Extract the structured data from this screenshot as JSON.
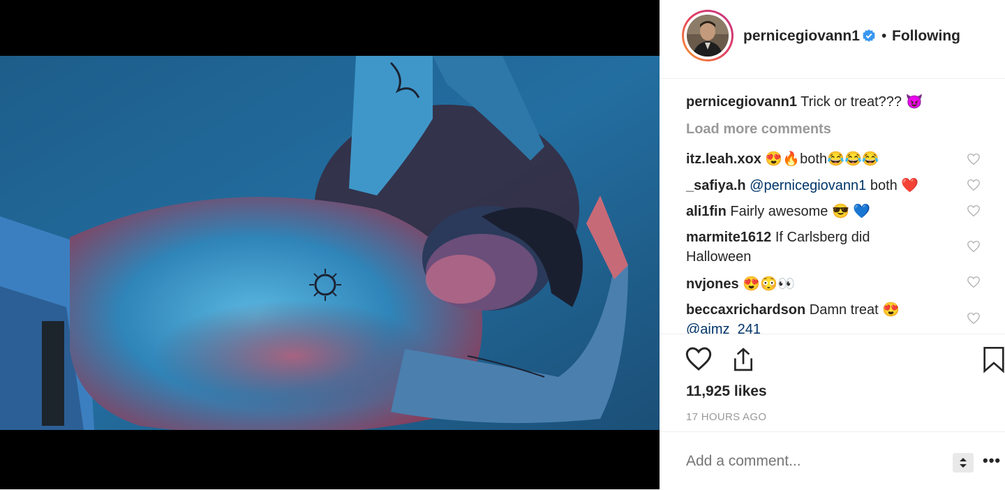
{
  "header": {
    "username": "pernicegiovann1",
    "separator": "•",
    "follow_status": "Following"
  },
  "caption": {
    "username": "pernicegiovann1",
    "text": "Trick or treat??? 😈"
  },
  "load_more": "Load more comments",
  "comments": [
    {
      "user": "itz.leah.xox",
      "pre": "",
      "mention": "",
      "text": "😍🔥both😂😂😂"
    },
    {
      "user": "_safiya.h",
      "pre": "",
      "mention": "@pernicegiovann1",
      "text": " both ❤️"
    },
    {
      "user": "ali1fin",
      "pre": "",
      "mention": "",
      "text": "Fairly awesome 😎 💙"
    },
    {
      "user": "marmite1612",
      "pre": "",
      "mention": "",
      "text": "If Carlsberg did Halloween"
    },
    {
      "user": "nvjones",
      "pre": "",
      "mention": "",
      "text": "😍😳👀"
    },
    {
      "user": "beccaxrichardson",
      "pre": "",
      "mention": "@aimz_241",
      "text": "Damn treat 😍"
    }
  ],
  "likes": "11,925 likes",
  "time": "17 HOURS AGO",
  "add_comment_placeholder": "Add a comment...",
  "more_label": "•••",
  "colors": {
    "accent_blue": "#3897f0",
    "mention": "#003569",
    "muted": "#999999"
  },
  "icons": [
    "verified-icon",
    "heart-icon",
    "share-icon",
    "bookmark-icon",
    "comment-heart-icon",
    "stepper-icon",
    "more-icon"
  ]
}
